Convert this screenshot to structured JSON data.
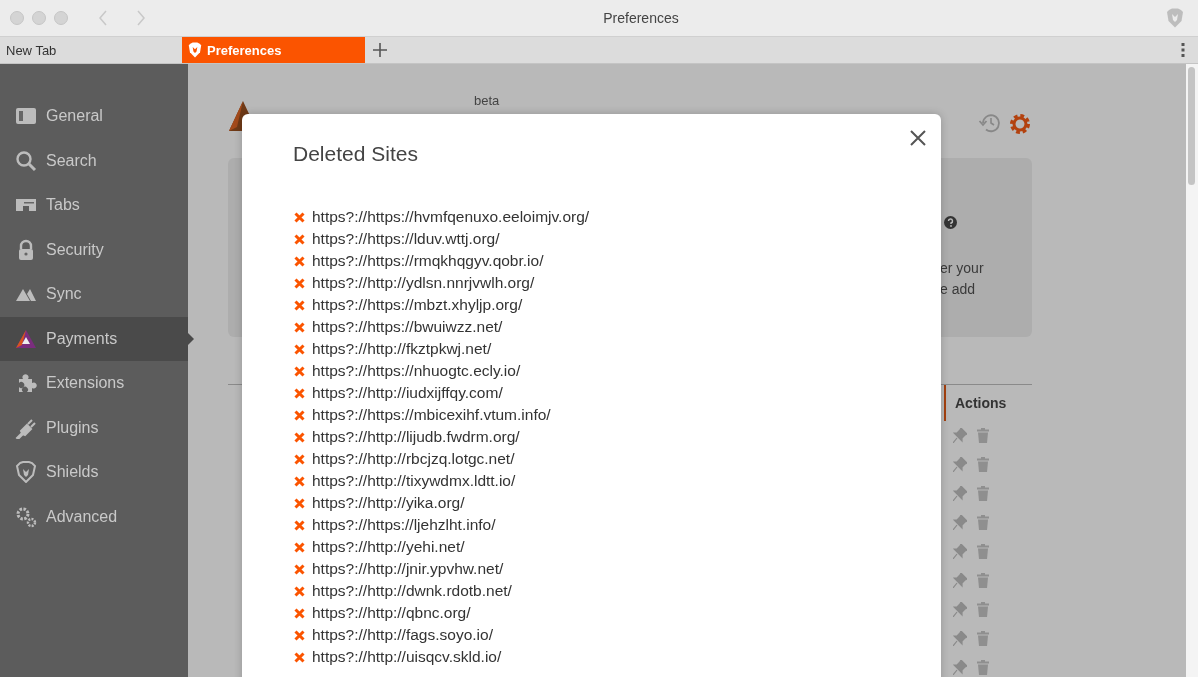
{
  "window": {
    "title": "Preferences"
  },
  "tabs": [
    {
      "label": "New Tab",
      "selected": false
    },
    {
      "label": "Preferences",
      "selected": true
    }
  ],
  "sidebar": {
    "items": [
      {
        "label": "General",
        "kind": "general",
        "selected": false
      },
      {
        "label": "Search",
        "kind": "search",
        "selected": false
      },
      {
        "label": "Tabs",
        "kind": "tabs",
        "selected": false
      },
      {
        "label": "Security",
        "kind": "lock",
        "selected": false
      },
      {
        "label": "Sync",
        "kind": "sync",
        "selected": false
      },
      {
        "label": "Payments",
        "kind": "payments",
        "selected": true
      },
      {
        "label": "Extensions",
        "kind": "puzzle",
        "selected": false
      },
      {
        "label": "Plugins",
        "kind": "plug",
        "selected": false
      },
      {
        "label": "Shields",
        "kind": "shield",
        "selected": false
      },
      {
        "label": "Advanced",
        "kind": "gears",
        "selected": false
      }
    ]
  },
  "page": {
    "beta_label": "beta",
    "card_text": [
      "er your",
      "e add"
    ],
    "table": {
      "columns": [
        "Actions"
      ]
    }
  },
  "modal": {
    "title": "Deleted Sites",
    "sites": [
      "https?://https://hvmfqenuxo.eeloimjv.org/",
      "https?://https://lduv.wttj.org/",
      "https?://https://rmqkhqgyv.qobr.io/",
      "https?://http://ydlsn.nnrjvwlh.org/",
      "https?://https://mbzt.xhyljp.org/",
      "https?://https://bwuiwzz.net/",
      "https?://http://fkztpkwj.net/",
      "https?://https://nhuogtc.ecly.io/",
      "https?://http://iudxijffqy.com/",
      "https?://https://mbicexihf.vtum.info/",
      "https?://http://lijudb.fwdrm.org/",
      "https?://http://rbcjzq.lotgc.net/",
      "https?://http://tixywdmx.ldtt.io/",
      "https?://http://yika.org/",
      "https?://https://ljehzlht.info/",
      "https?://http://yehi.net/",
      "https?://http://jnir.ypvhw.net/",
      "https?://http://dwnk.rdotb.net/",
      "https?://http://qbnc.org/",
      "https?://http://fags.soyo.io/",
      "https?://http://uisqcv.skld.io/"
    ]
  }
}
